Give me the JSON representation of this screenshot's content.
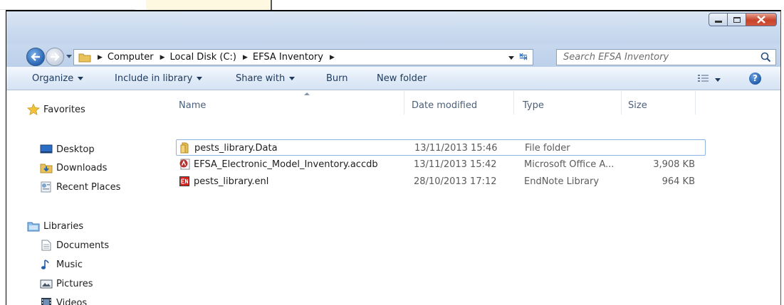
{
  "window": {
    "controls": {
      "minimize": "minimize",
      "maximize": "maximize",
      "close": "close"
    }
  },
  "address": {
    "crumbs": [
      "Computer",
      "Local Disk (C:)",
      "EFSA Inventory"
    ],
    "search_placeholder": "Search EFSA Inventory"
  },
  "toolbar": {
    "organize": "Organize",
    "include_in_library": "Include in library",
    "share_with": "Share with",
    "burn": "Burn",
    "new_folder": "New folder"
  },
  "nav": {
    "favorites": {
      "label": "Favorites",
      "items": [
        "Desktop",
        "Downloads",
        "Recent Places"
      ]
    },
    "libraries": {
      "label": "Libraries",
      "items": [
        "Documents",
        "Music",
        "Pictures",
        "Videos"
      ]
    }
  },
  "columns": {
    "name": "Name",
    "date": "Date modified",
    "type": "Type",
    "size": "Size"
  },
  "files": [
    {
      "name": "pests_library.Data",
      "date": "13/11/2013 15:46",
      "type": "File folder",
      "size": "",
      "icon": "folder-icon"
    },
    {
      "name": "EFSA_Electronic_Model_Inventory.accdb",
      "date": "13/11/2013 15:42",
      "type": "Microsoft Office A...",
      "size": "3,908 KB",
      "icon": "access-db-icon"
    },
    {
      "name": "pests_library.enl",
      "date": "28/10/2013 17:12",
      "type": "EndNote Library",
      "size": "964 KB",
      "icon": "endnote-icon"
    }
  ],
  "colors": {
    "titlebar": "#c9daef",
    "close": "#c7432a",
    "selection_border": "#8fb4e0"
  }
}
